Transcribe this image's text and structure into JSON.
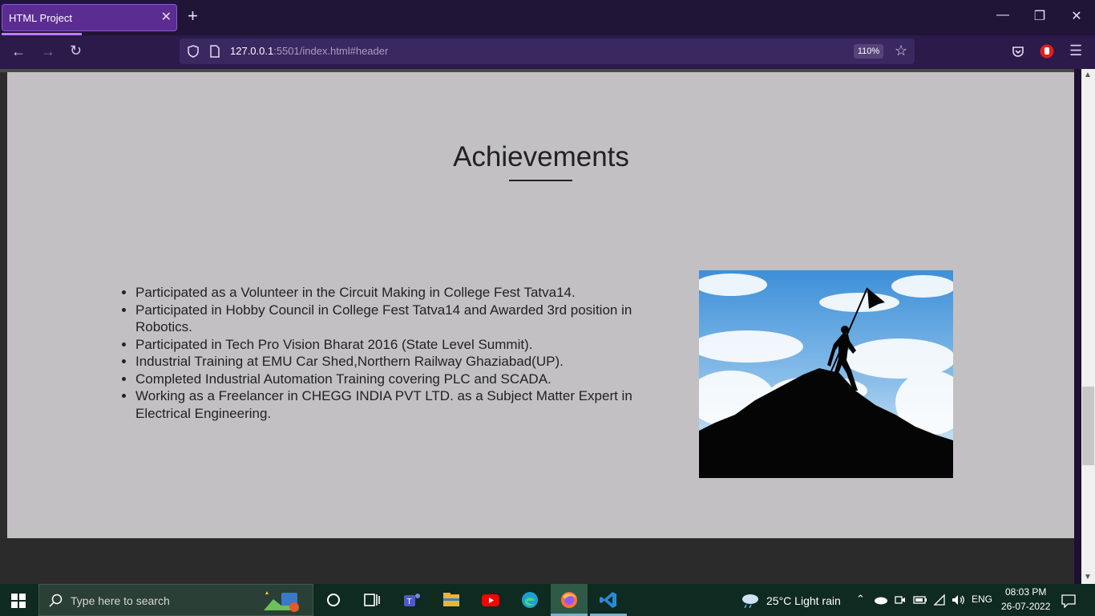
{
  "browser": {
    "tab_title": "HTML Project",
    "url_host": "127.0.0.1",
    "url_rest": ":5501/index.html#header",
    "zoom": "110%"
  },
  "page": {
    "heading": "Achievements",
    "achievements": [
      "Participated as a Volunteer in the Circuit Making in College Fest Tatva14.",
      "Participated in Hobby Council in College Fest Tatva14 and Awarded 3rd position in Robotics.",
      "Participated in Tech Pro Vision Bharat 2016 (State Level Summit).",
      "Industrial Training at EMU Car Shed,Northern Railway Ghaziabad(UP).",
      "Completed Industrial Automation Training covering PLC and SCADA.",
      "Working as a Freelancer in CHEGG INDIA PVT LTD. as a Subject Matter Expert in Electrical Engineering."
    ],
    "image_icon": "climber-with-flag-image"
  },
  "taskbar": {
    "search_placeholder": "Type here to search",
    "weather": "25°C  Light rain",
    "language": "ENG",
    "time": "08:03 PM",
    "date": "26-07-2022"
  },
  "colors": {
    "page_bg": "#c2c0c3",
    "firefox_tab": "#5b2d92",
    "taskbar": "#0f2a20"
  }
}
